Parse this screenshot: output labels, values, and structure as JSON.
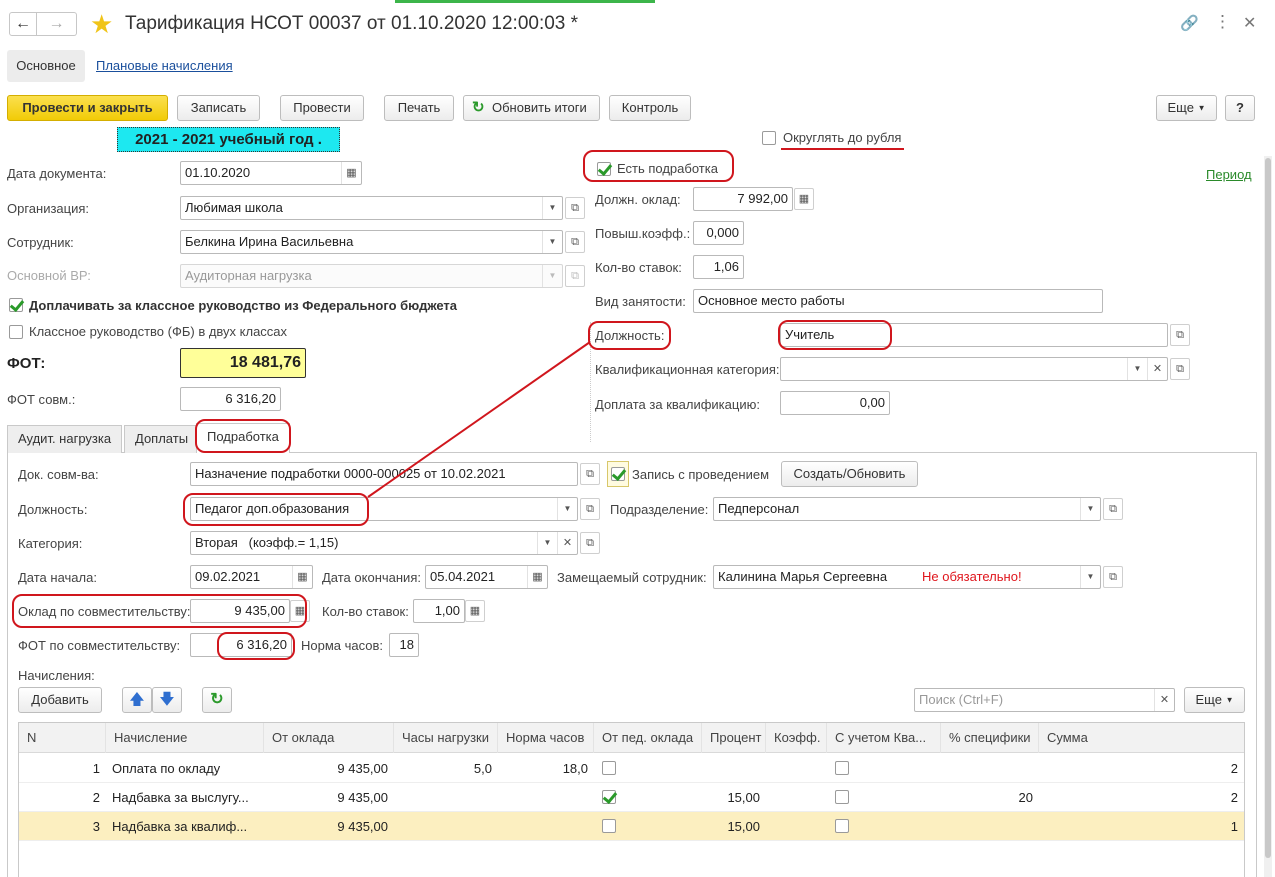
{
  "window": {
    "title": "Тарификация НСОТ 00037 от 01.10.2020 12:00:03 *"
  },
  "nav_tabs": {
    "main": "Основное",
    "planned": "Плановые начисления"
  },
  "toolbar": {
    "post_close": "Провести и закрыть",
    "save": "Записать",
    "post": "Провести",
    "print": "Печать",
    "refresh": "Обновить итоги",
    "control": "Контроль",
    "more": "Еще",
    "help": "?"
  },
  "banner": "2021 - 2021 учебный год .",
  "left": {
    "date_label": "Дата документа:",
    "date_value": "01.10.2020",
    "org_label": "Организация:",
    "org_value": "Любимая школа",
    "employee_label": "Сотрудник:",
    "employee_value": "Белкина Ирина Васильевна",
    "basic_vr_label": "Основной ВР:",
    "basic_vr_value": "Аудиторная нагрузка",
    "federal_check": "Доплачивать за классное руководство из Федерального бюджета",
    "two_classes_check": "Классное руководство (ФБ) в двух классах",
    "fot_label": "ФОТ:",
    "fot_value": "18 481,76",
    "fot_comb_label": "ФОТ совм.:",
    "fot_comb_value": "6 316,20"
  },
  "right": {
    "round_check": "Округлять до рубля",
    "extra_work_check": "Есть подработка",
    "period_link": "Период",
    "salary_label": "Должн. оклад:",
    "salary_value": "7 992,00",
    "coef_label": "Повыш.коэфф.:",
    "coef_value": "0,000",
    "rates_label": "Кол-во ставок:",
    "rates_value": "1,06",
    "employment_label": "Вид занятости:",
    "employment_value": "Основное место работы",
    "position_label": "Должность:",
    "position_value": "Учитель",
    "qual_label": "Квалификационная категория:",
    "qual_value": "",
    "qual_pay_label": "Доплата за квалификацию:",
    "qual_pay_value": "0,00"
  },
  "tabs": {
    "aud": "Аудит. нагрузка",
    "extra": "Доплаты",
    "sub": "Подработка"
  },
  "sub": {
    "doc_label": "Док. совм-ва:",
    "doc_value": "Назначение подработки 0000-000025 от 10.02.2021",
    "record_check": "Запись с проведением",
    "create_btn": "Создать/Обновить",
    "position_label": "Должность:",
    "position_value": "Педагог доп.образования",
    "division_label": "Подразделение:",
    "division_value": "Педперсонал",
    "category_label": "Категория:",
    "category_value": "Вторая   (коэфф.= 1,15)",
    "start_label": "Дата начала:",
    "start_value": "09.02.2021",
    "end_label": "Дата окончания:",
    "end_value": "05.04.2021",
    "replaced_label": "Замещаемый сотрудник:",
    "replaced_value": "Калинина Марья Сергеевна",
    "optional_note": "Не обязательно!",
    "salary_label": "Оклад по совместительству:",
    "salary_value": "9 435,00",
    "rates_label": "Кол-во ставок:",
    "rates_value": "1,00",
    "fot_label": "ФОТ по совместительству:",
    "fot_value": "6 316,20",
    "hours_label": "Норма часов:",
    "hours_value": "18",
    "accruals_label": "Начисления:",
    "add_btn": "Добавить",
    "search_placeholder": "Поиск (Ctrl+F)",
    "more": "Еще"
  },
  "table": {
    "headers": [
      "N",
      "Начисление",
      "От оклада",
      "Часы нагрузки",
      "Норма часов",
      "От пед. оклада",
      "Процент",
      "Коэфф.",
      "С учетом Ква...",
      "% специфики",
      "Сумма"
    ],
    "rows": [
      {
        "n": "1",
        "name": "Оплата по окладу",
        "salary": "9 435,00",
        "hours": "5,0",
        "norm": "18,0",
        "ped": false,
        "pct": "",
        "coef": "",
        "qual": false,
        "spec": "",
        "sum": "2"
      },
      {
        "n": "2",
        "name": "Надбавка за выслугу...",
        "salary": "9 435,00",
        "hours": "",
        "norm": "",
        "ped": true,
        "pct": "15,00",
        "coef": "",
        "qual": false,
        "spec": "20",
        "sum": "2"
      },
      {
        "n": "3",
        "name": "Надбавка за квалиф...",
        "salary": "9 435,00",
        "hours": "",
        "norm": "",
        "ped": false,
        "pct": "15,00",
        "coef": "",
        "qual": false,
        "spec": "",
        "sum": "1"
      }
    ]
  },
  "colors": {
    "primary_button": "#f5d40d",
    "banner_bg": "#1de8f0",
    "fot_bg": "#ffff99",
    "annotation_red": "#d0161d",
    "selected_row": "#fcefc0"
  }
}
